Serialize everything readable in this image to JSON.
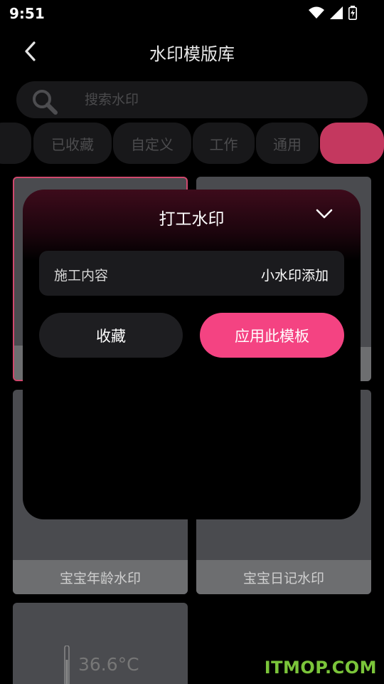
{
  "status_bar": {
    "time": "9:51"
  },
  "header": {
    "title": "水印模版库"
  },
  "search": {
    "placeholder": "搜索水印"
  },
  "tabs": [
    {
      "label": ""
    },
    {
      "label": "已收藏"
    },
    {
      "label": "自定义"
    },
    {
      "label": "工作"
    },
    {
      "label": "通用"
    },
    {
      "label": ""
    }
  ],
  "cards": [
    {
      "label": ""
    },
    {
      "label": ""
    },
    {
      "label": "宝宝年龄水印"
    },
    {
      "label": "宝宝日记水印"
    },
    {
      "preview_text": "36.6°C"
    }
  ],
  "sheet": {
    "title": "打工水印",
    "field_label": "施工内容",
    "field_value": "小水印添加",
    "favorite_label": "收藏",
    "apply_label": "应用此模板"
  },
  "watermark": "ITMOP.COM",
  "colors": {
    "accent": "#f44382",
    "active_tab": "#c4385f",
    "background": "#000000"
  }
}
